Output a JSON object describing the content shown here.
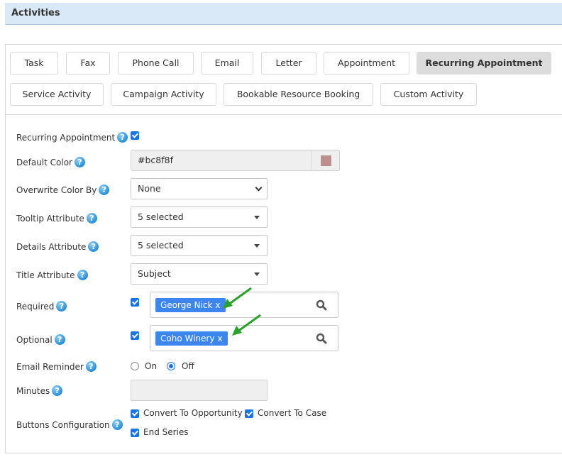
{
  "header": {
    "title": "Activities"
  },
  "tabs": [
    {
      "label": "Task",
      "active": false
    },
    {
      "label": "Fax",
      "active": false
    },
    {
      "label": "Phone Call",
      "active": false
    },
    {
      "label": "Email",
      "active": false
    },
    {
      "label": "Letter",
      "active": false
    },
    {
      "label": "Appointment",
      "active": false
    },
    {
      "label": "Recurring Appointment",
      "active": true
    },
    {
      "label": "Service Activity",
      "active": false
    },
    {
      "label": "Campaign Activity",
      "active": false
    },
    {
      "label": "Bookable Resource Booking",
      "active": false
    },
    {
      "label": "Custom Activity",
      "active": false
    }
  ],
  "form": {
    "recurring_appointment": {
      "label": "Recurring Appointment",
      "checked": true
    },
    "default_color": {
      "label": "Default Color",
      "value": "#bc8f8f",
      "swatch": "#bc8f8f"
    },
    "overwrite_color_by": {
      "label": "Overwrite Color By",
      "value": "None"
    },
    "tooltip_attribute": {
      "label": "Tooltip Attribute",
      "value": "5 selected"
    },
    "details_attribute": {
      "label": "Details Attribute",
      "value": "5 selected"
    },
    "title_attribute": {
      "label": "Title Attribute",
      "value": "Subject"
    },
    "required": {
      "label": "Required",
      "checked": true,
      "tag": "George Nick",
      "remove": "x"
    },
    "optional": {
      "label": "Optional",
      "checked": true,
      "tag": "Coho Winery",
      "remove": "x"
    },
    "email_reminder": {
      "label": "Email Reminder",
      "options": [
        "On",
        "Off"
      ],
      "selected": "Off"
    },
    "minutes": {
      "label": "Minutes",
      "value": ""
    },
    "buttons_configuration": {
      "label": "Buttons Configuration",
      "options": [
        {
          "label": "Convert To Opportunity",
          "checked": true
        },
        {
          "label": "Convert To Case",
          "checked": true
        },
        {
          "label": "End Series",
          "checked": true
        }
      ]
    }
  },
  "help_glyph": "?",
  "colors": {
    "accent": "#1a73e8",
    "tag": "#3d86f0",
    "header_bg": "#d9e9f7",
    "annotation_arrow": "#2aa12a"
  }
}
